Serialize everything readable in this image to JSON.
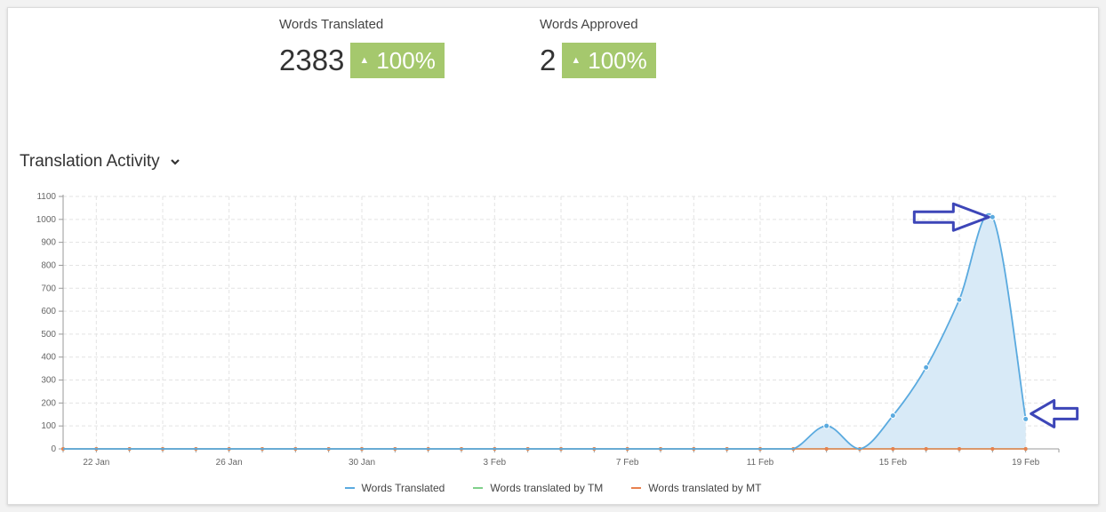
{
  "stats": {
    "translated": {
      "label": "Words Translated",
      "value": "2383",
      "change": "100%"
    },
    "approved": {
      "label": "Words Approved",
      "value": "2",
      "change": "100%"
    }
  },
  "section": {
    "title": "Translation Activity",
    "toggle_icon": "chevron-down-icon"
  },
  "colors": {
    "badge_green": "#a5c86d",
    "translated": "#5aaadf",
    "translated_fill": "#d8eaf7",
    "tm": "#7fd08a",
    "mt": "#e8804e",
    "annotation": "#3d46b8"
  },
  "chart_data": {
    "type": "area",
    "title": "Translation Activity",
    "x": [
      "21 Jan",
      "22 Jan",
      "23 Jan",
      "24 Jan",
      "25 Jan",
      "26 Jan",
      "27 Jan",
      "28 Jan",
      "29 Jan",
      "30 Jan",
      "31 Jan",
      "1 Feb",
      "2 Feb",
      "3 Feb",
      "4 Feb",
      "5 Feb",
      "6 Feb",
      "7 Feb",
      "8 Feb",
      "9 Feb",
      "10 Feb",
      "11 Feb",
      "12 Feb",
      "13 Feb",
      "14 Feb",
      "15 Feb",
      "16 Feb",
      "17 Feb",
      "18 Feb",
      "19 Feb",
      "20 Feb"
    ],
    "x_tick_labels": [
      "22 Jan",
      "26 Jan",
      "30 Jan",
      "3 Feb",
      "7 Feb",
      "11 Feb",
      "15 Feb",
      "19 Feb"
    ],
    "y_ticks": [
      0,
      100,
      200,
      300,
      400,
      500,
      600,
      700,
      800,
      900,
      1000,
      1100
    ],
    "ylim": [
      0,
      1100
    ],
    "grid": true,
    "legend_position": "bottom",
    "series": [
      {
        "name": "Words Translated",
        "values": [
          0,
          0,
          0,
          0,
          0,
          0,
          0,
          0,
          0,
          0,
          0,
          0,
          0,
          0,
          0,
          0,
          0,
          0,
          0,
          0,
          0,
          0,
          0,
          100,
          0,
          145,
          355,
          650,
          1010,
          130
        ]
      },
      {
        "name": "Words translated by TM",
        "values": [
          0,
          0,
          0,
          0,
          0,
          0,
          0,
          0,
          0,
          0,
          0,
          0,
          0,
          0,
          0,
          0,
          0,
          0,
          0,
          0,
          0,
          0,
          0,
          0,
          0,
          0,
          0,
          0,
          0,
          0
        ]
      },
      {
        "name": "Words translated by MT",
        "values": [
          0,
          0,
          0,
          0,
          0,
          0,
          0,
          0,
          0,
          0,
          0,
          0,
          0,
          0,
          0,
          0,
          0,
          0,
          0,
          0,
          0,
          0,
          0,
          0,
          0,
          0,
          0,
          0,
          0,
          0
        ]
      }
    ],
    "annotations": [
      {
        "type": "arrow",
        "direction": "right",
        "points_to_index": 28
      },
      {
        "type": "arrow",
        "direction": "left",
        "points_to_index": 29
      }
    ]
  }
}
